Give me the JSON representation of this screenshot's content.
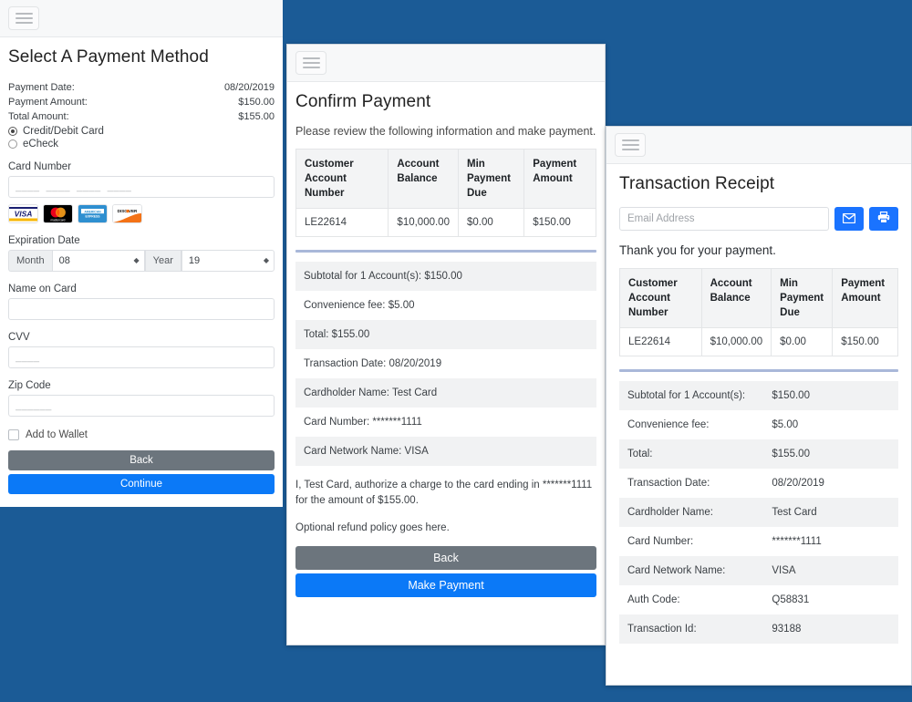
{
  "theme": {
    "background_blue": "#1b5b96",
    "primary_blue": "#0b79f7",
    "icon_blue": "#1a73ff",
    "secondary_gray": "#6c757d",
    "divider_blue": "#a9b8d9"
  },
  "payment_method_panel": {
    "title": "Select A Payment Method",
    "summary": [
      {
        "label": "Payment Date:",
        "value": "08/20/2019"
      },
      {
        "label": "Payment Amount:",
        "value": "$150.00"
      },
      {
        "label": "Total Amount:",
        "value": "$155.00"
      }
    ],
    "methods": [
      {
        "label": "Credit/Debit Card",
        "selected": true
      },
      {
        "label": "eCheck",
        "selected": false
      }
    ],
    "card_number": {
      "label": "Card Number",
      "value": "",
      "placeholder": "____  ____  ____  ____"
    },
    "accepted_cards": [
      "visa-icon",
      "mastercard-icon",
      "amex-icon",
      "discover-icon"
    ],
    "expiration": {
      "label": "Expiration Date",
      "month_addon": "Month",
      "month_value": "08",
      "year_addon": "Year",
      "year_value": "19"
    },
    "name_on_card": {
      "label": "Name on Card",
      "value": "",
      "placeholder": ""
    },
    "cvv": {
      "label": "CVV",
      "value": "",
      "placeholder": "____"
    },
    "zip_code": {
      "label": "Zip Code",
      "value": "",
      "placeholder": "______"
    },
    "add_to_wallet": {
      "label": "Add to Wallet",
      "checked": false
    },
    "back_label": "Back",
    "continue_label": "Continue"
  },
  "confirm_panel": {
    "title": "Confirm Payment",
    "lead": "Please review the following information and make payment.",
    "table": {
      "headers": [
        "Customer Account Number",
        "Account Balance",
        "Min Payment Due",
        "Payment Amount"
      ],
      "rows": [
        [
          "LE22614",
          "$10,000.00",
          "$0.00",
          "$150.00"
        ]
      ]
    },
    "details": [
      "Subtotal for 1 Account(s): $150.00",
      "Convenience fee: $5.00",
      "Total: $155.00",
      "Transaction Date: 08/20/2019",
      "Cardholder Name: Test Card",
      "Card Number: *******1111",
      "Card Network Name: VISA"
    ],
    "authorization": "I, Test Card, authorize a charge to the card ending in *******1111 for the amount of $155.00.",
    "refund_policy": "Optional refund policy goes here.",
    "back_label": "Back",
    "make_payment_label": "Make Payment"
  },
  "receipt_panel": {
    "title": "Transaction Receipt",
    "email": {
      "value": "",
      "placeholder": "Email Address"
    },
    "email_button_icon": "envelope-icon",
    "print_button_icon": "printer-icon",
    "thank_you": "Thank you for your payment.",
    "table": {
      "headers": [
        "Customer Account Number",
        "Account Balance",
        "Min Payment Due",
        "Payment Amount"
      ],
      "rows": [
        [
          "LE22614",
          "$10,000.00",
          "$0.00",
          "$150.00"
        ]
      ]
    },
    "details": [
      {
        "label": "Subtotal for 1 Account(s):",
        "value": "$150.00"
      },
      {
        "label": "Convenience fee:",
        "value": "$5.00"
      },
      {
        "label": "Total:",
        "value": "$155.00"
      },
      {
        "label": "Transaction Date:",
        "value": "08/20/2019"
      },
      {
        "label": "Cardholder Name:",
        "value": "Test Card"
      },
      {
        "label": "Card Number:",
        "value": "*******1111"
      },
      {
        "label": "Card Network Name:",
        "value": "VISA"
      },
      {
        "label": "Auth Code:",
        "value": "Q58831"
      },
      {
        "label": "Transaction Id:",
        "value": "93188"
      }
    ]
  }
}
